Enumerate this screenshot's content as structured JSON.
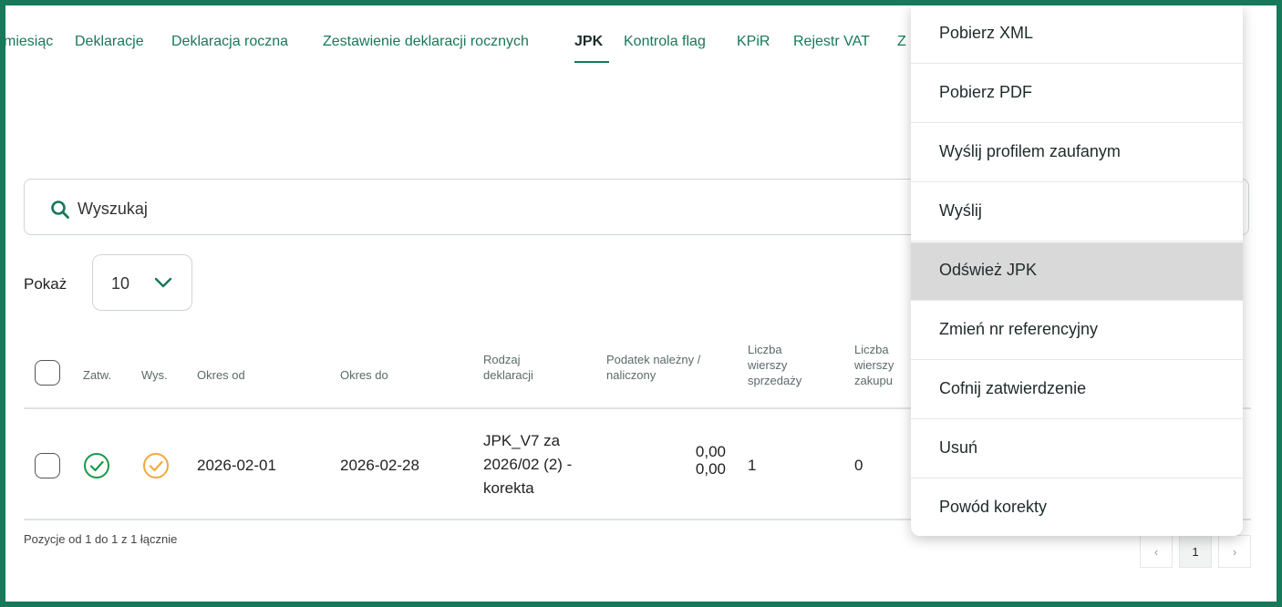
{
  "tabs": [
    {
      "label": "miesiąc"
    },
    {
      "label": "Deklaracje"
    },
    {
      "label": "Deklaracja roczna"
    },
    {
      "label": "Zestawienie deklaracji rocznych"
    },
    {
      "label": "JPK"
    },
    {
      "label": "Kontrola flag"
    },
    {
      "label": "KPiR"
    },
    {
      "label": "Rejestr VAT"
    },
    {
      "label": "Z"
    }
  ],
  "search": {
    "placeholder": "Wyszukaj"
  },
  "page_size": {
    "label": "Pokaż",
    "value": "10"
  },
  "table": {
    "headers": {
      "approved": "Zatw.",
      "sent": "Wys.",
      "period_from": "Okres od",
      "period_to": "Okres do",
      "decl_type": [
        "Rodzaj",
        "deklaracji"
      ],
      "tax": [
        "Podatek należny /",
        "naliczony"
      ],
      "sales_rows": [
        "Liczba",
        "wierszy",
        "sprzedaży"
      ],
      "purchase_rows": [
        "Liczba",
        "wierszy",
        "zakupu"
      ]
    },
    "rows": [
      {
        "period_from": "2026-02-01",
        "period_to": "2026-02-28",
        "decl_type": [
          "JPK_V7 za",
          "2026/02 (2) -",
          "korekta"
        ],
        "tax": [
          "0,00",
          "0,00"
        ],
        "sales_rows": "1",
        "purchase_rows": "0"
      }
    ]
  },
  "footer": {
    "info": "Pozycje od 1 do 1 z 1 łącznie",
    "current_page": "1",
    "prev": "‹",
    "next": "›"
  },
  "menu": {
    "items": [
      {
        "label": "Pobierz XML"
      },
      {
        "label": "Pobierz PDF"
      },
      {
        "label": "Wyślij profilem zaufanym"
      },
      {
        "label": "Wyślij"
      },
      {
        "label": "Odśwież JPK"
      },
      {
        "label": "Zmień nr referencyjny"
      },
      {
        "label": "Cofnij zatwierdzenie"
      },
      {
        "label": "Usuń"
      },
      {
        "label": "Powód korekty"
      }
    ],
    "highlighted": "Odśwież JPK"
  },
  "colors": {
    "accent": "#17785a",
    "approved_icon": "#1a9a4a",
    "sent_icon": "#f2a93b",
    "highlight": "#d9d9d9"
  }
}
